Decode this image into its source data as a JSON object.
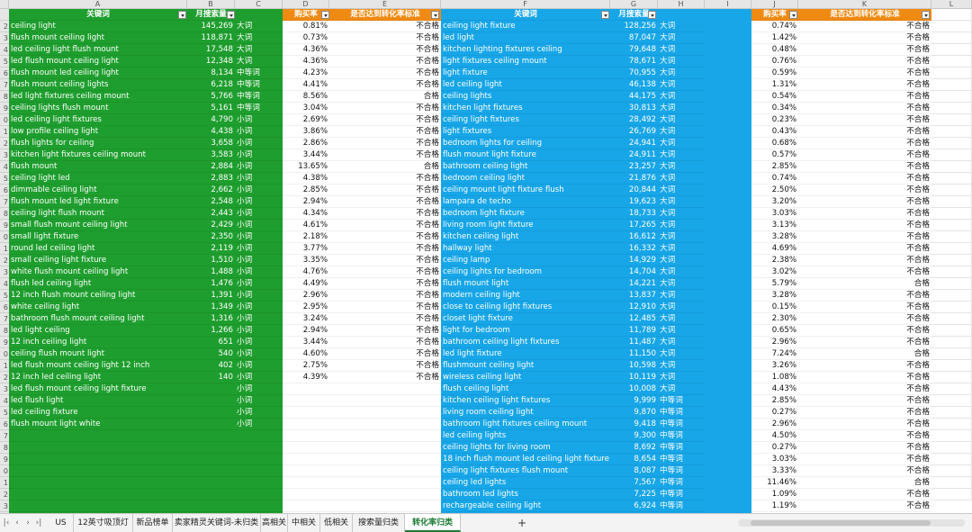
{
  "column_letters": [
    "A",
    "B",
    "C",
    "D",
    "E",
    "F",
    "G",
    "H",
    "I",
    "J",
    "K",
    "L"
  ],
  "headers": {
    "left_keyword": "关键词",
    "left_volume": "月搜索量",
    "left_buy_rate": "购买率",
    "left_standard": "是否达到转化率标准",
    "right_keyword": "关键词",
    "right_volume": "月搜索量",
    "right_buy_rate": "购买率",
    "right_standard": "是否达到转化率标准"
  },
  "left_rows": [
    [
      "ceiling light",
      "145,269",
      "大词",
      "0.81%",
      "不合格"
    ],
    [
      "flush mount ceiling light",
      "118,871",
      "大词",
      "0.73%",
      "不合格"
    ],
    [
      "led ceiling light flush mount",
      "17,548",
      "大词",
      "4.36%",
      "不合格"
    ],
    [
      "led flush mount ceiling light",
      "12,348",
      "大词",
      "4.36%",
      "不合格"
    ],
    [
      "flush mount led ceiling light",
      "8,134",
      "中等词",
      "4.23%",
      "不合格"
    ],
    [
      "flush mount ceiling lights",
      "6,218",
      "中等词",
      "4.41%",
      "不合格"
    ],
    [
      "led light fixtures ceiling mount",
      "5,766",
      "中等词",
      "8.56%",
      "合格"
    ],
    [
      "ceiling lights flush mount",
      "5,161",
      "中等词",
      "3.04%",
      "不合格"
    ],
    [
      "led ceiling light fixtures",
      "4,790",
      "小词",
      "2.69%",
      "不合格"
    ],
    [
      "low profile ceiling light",
      "4,438",
      "小词",
      "3.86%",
      "不合格"
    ],
    [
      "flush lights for ceiling",
      "3,658",
      "小词",
      "2.86%",
      "不合格"
    ],
    [
      "kitchen light fixtures ceiling mount",
      "3,583",
      "小词",
      "3.44%",
      "不合格"
    ],
    [
      "flush mount",
      "2,884",
      "小词",
      "13.65%",
      "合格"
    ],
    [
      "ceiling light led",
      "2,883",
      "小词",
      "4.38%",
      "不合格"
    ],
    [
      "dimmable ceiling light",
      "2,662",
      "小词",
      "2.85%",
      "不合格"
    ],
    [
      "flush mount led light fixture",
      "2,548",
      "小词",
      "2.94%",
      "不合格"
    ],
    [
      "ceiling light flush mount",
      "2,443",
      "小词",
      "4.34%",
      "不合格"
    ],
    [
      "small flush mount ceiling light",
      "2,429",
      "小词",
      "4.61%",
      "不合格"
    ],
    [
      "small light fixture",
      "2,350",
      "小词",
      "2.18%",
      "不合格"
    ],
    [
      "round led ceiling light",
      "2,119",
      "小词",
      "3.77%",
      "不合格"
    ],
    [
      "small ceiling light fixture",
      "1,510",
      "小词",
      "3.35%",
      "不合格"
    ],
    [
      "white flush mount ceiling light",
      "1,488",
      "小词",
      "4.76%",
      "不合格"
    ],
    [
      "flush led ceiling light",
      "1,476",
      "小词",
      "4.49%",
      "不合格"
    ],
    [
      "12 inch flush mount ceiling light",
      "1,391",
      "小词",
      "2.96%",
      "不合格"
    ],
    [
      "white ceiling light",
      "1,349",
      "小词",
      "2.95%",
      "不合格"
    ],
    [
      "bathroom flush mount ceiling light",
      "1,316",
      "小词",
      "3.24%",
      "不合格"
    ],
    [
      "led light ceiling",
      "1,266",
      "小词",
      "2.94%",
      "不合格"
    ],
    [
      "12 inch ceiling light",
      "651",
      "小词",
      "3.44%",
      "不合格"
    ],
    [
      "ceiling flush mount light",
      "540",
      "小词",
      "4.60%",
      "不合格"
    ],
    [
      "led flush mount ceiling light 12 inch",
      "402",
      "小词",
      "2.75%",
      "不合格"
    ],
    [
      "12 inch led ceiling light",
      "140",
      "小词",
      "4.39%",
      "不合格"
    ],
    [
      "led flush mount ceiling light fixture",
      "",
      "小词",
      "",
      ""
    ],
    [
      "led flush light",
      "",
      "小词",
      "",
      ""
    ],
    [
      "led ceiling fixture",
      "",
      "小词",
      "",
      ""
    ],
    [
      "flush mount light white",
      "",
      "小词",
      "",
      ""
    ],
    [
      "",
      "",
      "",
      "",
      ""
    ],
    [
      "",
      "",
      "",
      "",
      ""
    ],
    [
      "",
      "",
      "",
      "",
      ""
    ],
    [
      "",
      "",
      "",
      "",
      ""
    ],
    [
      "",
      "",
      "",
      "",
      ""
    ],
    [
      "",
      "",
      "",
      "",
      ""
    ],
    [
      "",
      "",
      "",
      "",
      ""
    ],
    [
      "",
      "",
      "",
      "",
      ""
    ]
  ],
  "right_rows": [
    [
      "ceiling light fixture",
      "128,256",
      "大词",
      "0.74%",
      "不合格"
    ],
    [
      "led light",
      "87,047",
      "大词",
      "1.42%",
      "不合格"
    ],
    [
      "kitchen lighting fixtures ceiling",
      "79,648",
      "大词",
      "0.48%",
      "不合格"
    ],
    [
      "light fixtures ceiling mount",
      "78,671",
      "大词",
      "0.76%",
      "不合格"
    ],
    [
      "light fixture",
      "70,955",
      "大词",
      "0.59%",
      "不合格"
    ],
    [
      "led ceiling light",
      "46,138",
      "大词",
      "1.31%",
      "不合格"
    ],
    [
      "ceiling lights",
      "44,175",
      "大词",
      "0.54%",
      "不合格"
    ],
    [
      "kitchen light fixtures",
      "30,813",
      "大词",
      "0.34%",
      "不合格"
    ],
    [
      "ceiling light fixtures",
      "28,492",
      "大词",
      "0.23%",
      "不合格"
    ],
    [
      "light fixtures",
      "26,769",
      "大词",
      "0.43%",
      "不合格"
    ],
    [
      "bedroom lights for ceiling",
      "24,941",
      "大词",
      "0.68%",
      "不合格"
    ],
    [
      "flush mount light fixture",
      "24,911",
      "大词",
      "0.57%",
      "不合格"
    ],
    [
      "bathroom ceiling light",
      "23,257",
      "大词",
      "2.85%",
      "不合格"
    ],
    [
      "bedroom ceiling light",
      "21,876",
      "大词",
      "0.74%",
      "不合格"
    ],
    [
      "ceiling mount light fixture flush",
      "20,844",
      "大词",
      "2.50%",
      "不合格"
    ],
    [
      "lampara de techo",
      "19,623",
      "大词",
      "3.20%",
      "不合格"
    ],
    [
      "bedroom light fixture",
      "18,733",
      "大词",
      "3.03%",
      "不合格"
    ],
    [
      "living room light fixture",
      "17,265",
      "大词",
      "3.13%",
      "不合格"
    ],
    [
      "kitchen ceiling light",
      "16,612",
      "大词",
      "3.28%",
      "不合格"
    ],
    [
      "hallway light",
      "16,332",
      "大词",
      "4.69%",
      "不合格"
    ],
    [
      "ceiling lamp",
      "14,929",
      "大词",
      "2.38%",
      "不合格"
    ],
    [
      "ceiling lights for bedroom",
      "14,704",
      "大词",
      "3.02%",
      "不合格"
    ],
    [
      "flush mount light",
      "14,221",
      "大词",
      "5.79%",
      "合格"
    ],
    [
      "modern ceiling light",
      "13,837",
      "大词",
      "3.28%",
      "不合格"
    ],
    [
      "close to ceiling light fixtures",
      "12,910",
      "大词",
      "0.15%",
      "不合格"
    ],
    [
      "closet light fixture",
      "12,485",
      "大词",
      "2.30%",
      "不合格"
    ],
    [
      "light for bedroom",
      "11,789",
      "大词",
      "0.65%",
      "不合格"
    ],
    [
      "bathroom ceiling light fixtures",
      "11,487",
      "大词",
      "2.96%",
      "不合格"
    ],
    [
      "led light fixture",
      "11,150",
      "大词",
      "7.24%",
      "合格"
    ],
    [
      "flushmount ceiling light",
      "10,598",
      "大词",
      "3.26%",
      "不合格"
    ],
    [
      "wireless ceiling light",
      "10,119",
      "大词",
      "1.08%",
      "不合格"
    ],
    [
      "flush ceiling light",
      "10,008",
      "大词",
      "4.43%",
      "不合格"
    ],
    [
      "kitchen ceiling light fixtures",
      "9,999",
      "中等词",
      "2.85%",
      "不合格"
    ],
    [
      "living room ceiling light",
      "9,870",
      "中等词",
      "0.27%",
      "不合格"
    ],
    [
      "bathroom light fixtures ceiling mount",
      "9,418",
      "中等词",
      "2.96%",
      "不合格"
    ],
    [
      "led ceiling lights",
      "9,300",
      "中等词",
      "4.50%",
      "不合格"
    ],
    [
      "ceiling lights for living room",
      "8,692",
      "中等词",
      "0.27%",
      "不合格"
    ],
    [
      "18 inch flush mount led ceiling light fixture",
      "8,654",
      "中等词",
      "3.03%",
      "不合格"
    ],
    [
      "ceiling light fixtures flush mount",
      "8,087",
      "中等词",
      "3.33%",
      "不合格"
    ],
    [
      "ceiling led lights",
      "7,567",
      "中等词",
      "11.46%",
      "合格"
    ],
    [
      "bathroom led lights",
      "7,225",
      "中等词",
      "1.09%",
      "不合格"
    ],
    [
      "rechargeable ceiling light",
      "6,924",
      "中等词",
      "1.19%",
      "不合格"
    ],
    [
      "",
      "",
      "",
      "",
      ""
    ]
  ],
  "row_numbers": [
    "",
    "2",
    "3",
    "4",
    "5",
    "6",
    "7",
    "8",
    "9",
    "0",
    "1",
    "2",
    "3",
    "4",
    "5",
    "6",
    "7",
    "8",
    "9",
    "0",
    "1",
    "2",
    "3",
    "4",
    "5",
    "6",
    "7",
    "8",
    "9",
    "0",
    "1",
    "2",
    "3",
    "4",
    "5",
    "6",
    "7",
    "8",
    "9",
    "0",
    "1",
    "2",
    "3",
    "4"
  ],
  "tabs": [
    "US",
    "12英寸吸顶灯",
    "新品榜单",
    "卖家精灵关键词-未归类",
    "高相关",
    "中相关",
    "低相关",
    "搜索量归类",
    "转化率归类"
  ],
  "active_tab": "转化率归类",
  "add_tab_label": "+",
  "colors": {
    "green": "#1e9e2e",
    "blue": "#17a6e8",
    "orange": "#ef8a12"
  }
}
